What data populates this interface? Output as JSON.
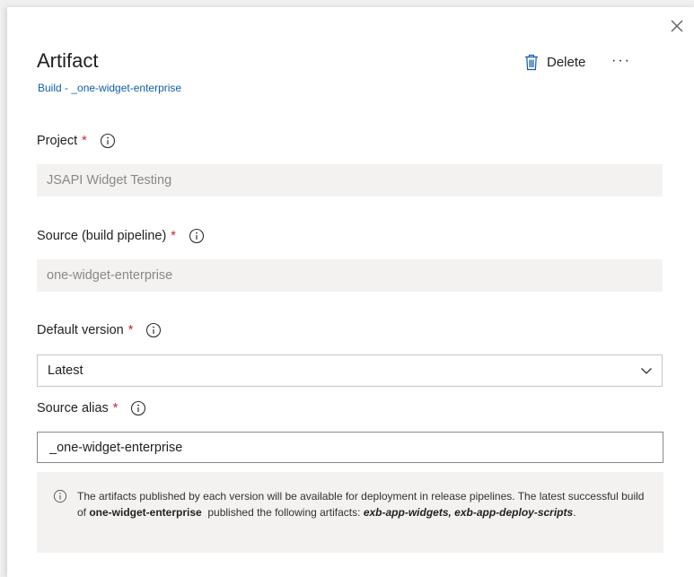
{
  "panel": {
    "title": "Artifact",
    "subtitle": "Build - _one-widget-enterprise",
    "delete_label": "Delete",
    "more_label": "···"
  },
  "fields": {
    "project": {
      "label": "Project",
      "required_mark": "*",
      "value": "JSAPI Widget Testing"
    },
    "source": {
      "label": "Source (build pipeline)",
      "required_mark": "*",
      "value": "one-widget-enterprise"
    },
    "default_version": {
      "label": "Default version",
      "required_mark": "*",
      "selected": "Latest"
    },
    "source_alias": {
      "label": "Source alias",
      "required_mark": "*",
      "value": "_one-widget-enterprise"
    }
  },
  "info_message": {
    "text_1": "The artifacts published by each version will be available for deployment in release pipelines. The latest successful build of ",
    "pipeline_name": "one-widget-enterprise",
    "text_2": "  published the following artifacts: ",
    "artifacts": "exb-app-widgets, exb-app-deploy-scripts",
    "text_3": "."
  },
  "icons": {
    "close": "close-icon",
    "delete": "trash-icon",
    "info": "info-icon",
    "chevron": "chevron-down-icon"
  },
  "colors": {
    "link": "#0f5ea8",
    "required": "#c1272d",
    "readonly_bg": "#f3f2f1",
    "muted_text": "#8a8886"
  }
}
